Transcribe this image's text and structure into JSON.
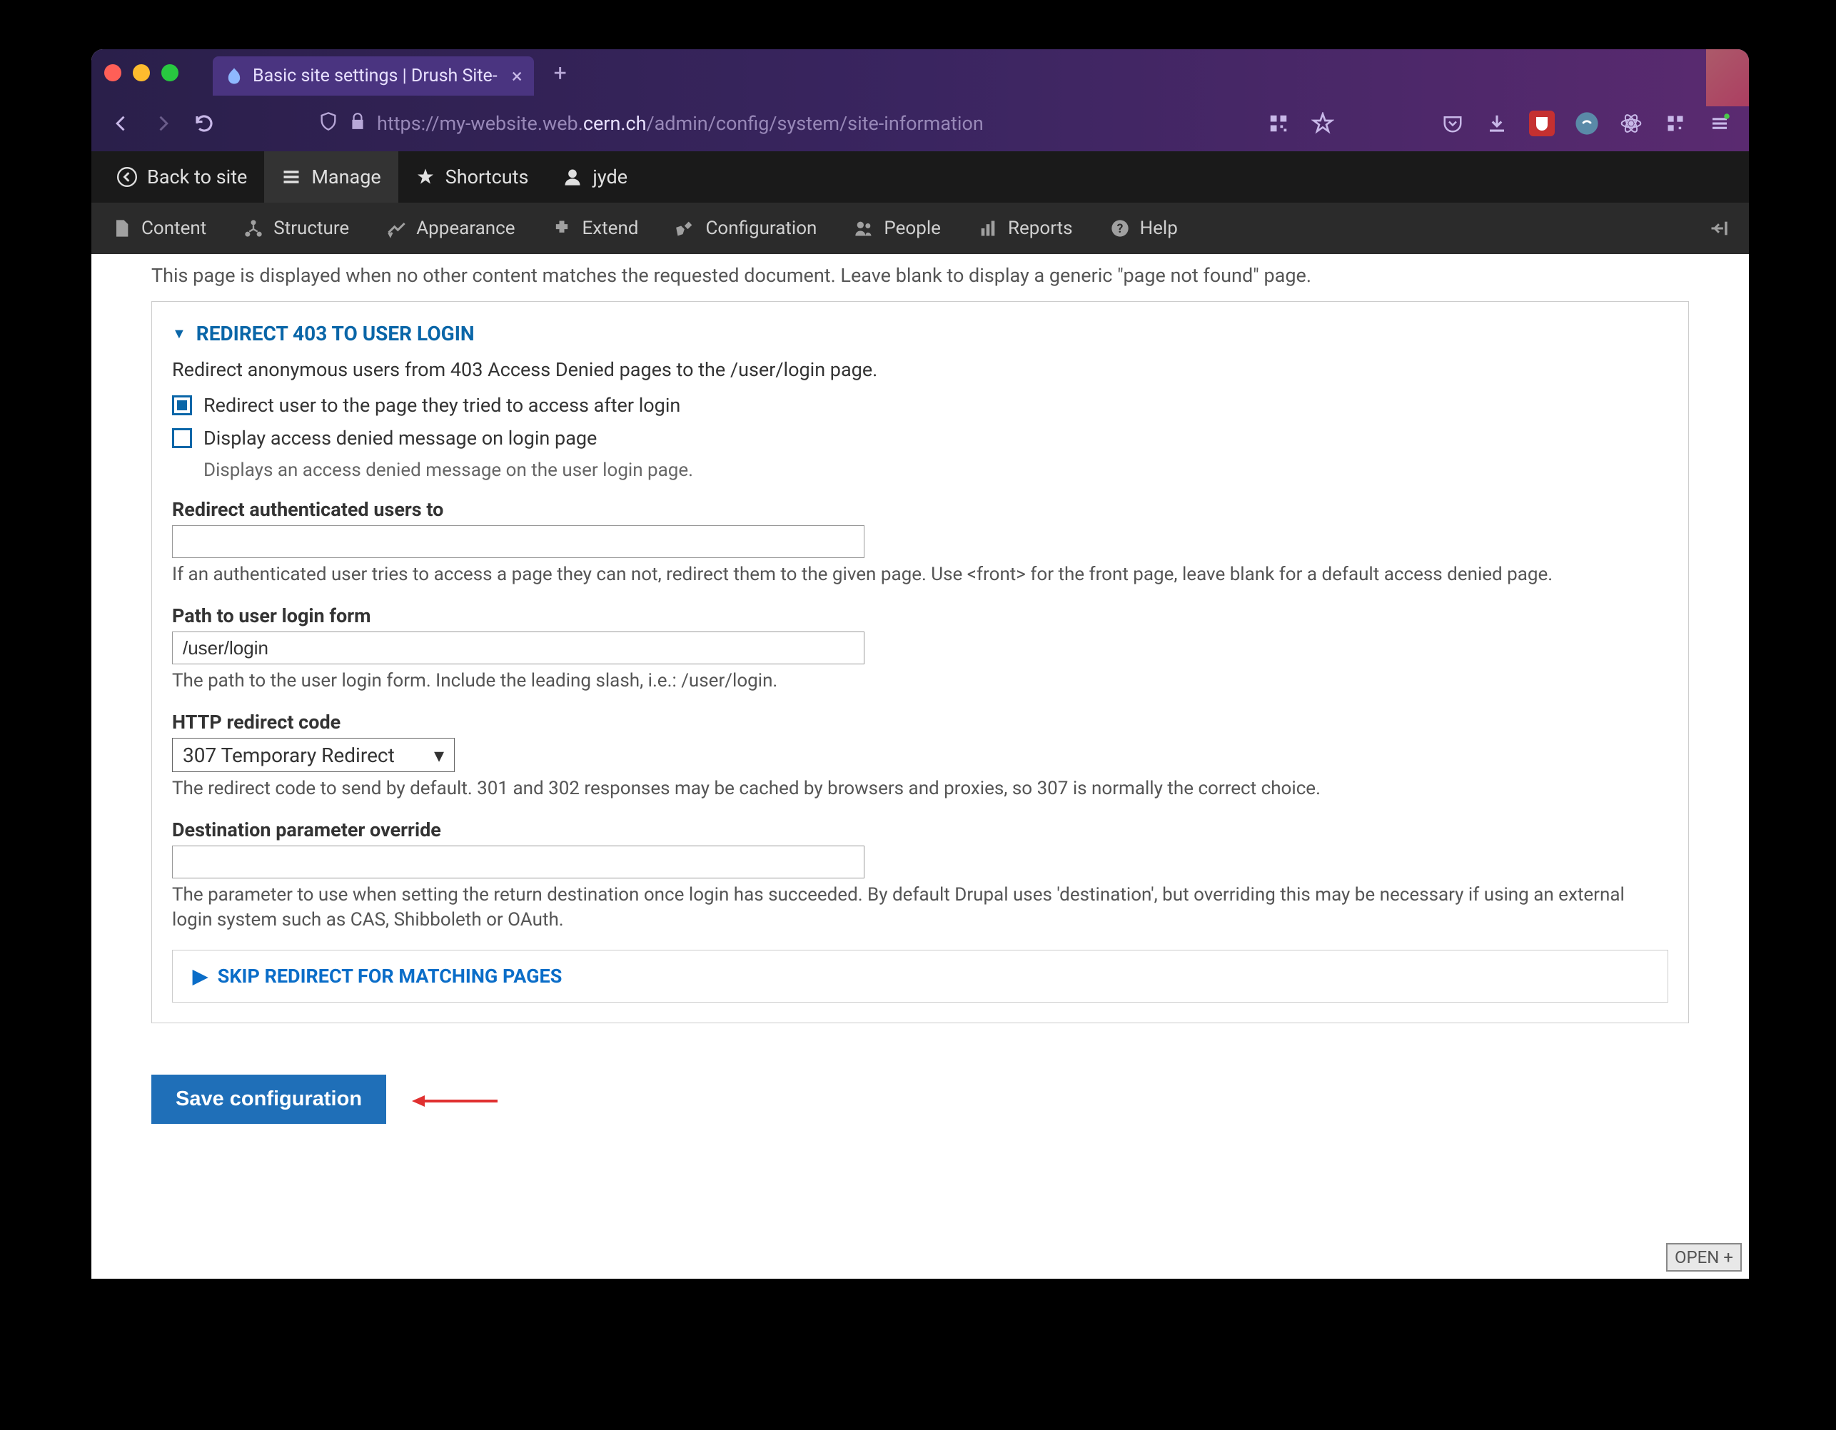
{
  "browser": {
    "tab_title": "Basic site settings | Drush Site-",
    "url_prefix": "https://my-website.web.",
    "url_domain": "cern.ch",
    "url_path": "/admin/config/system/site-information"
  },
  "admin_bar_1": {
    "back_to_site": "Back to site",
    "manage": "Manage",
    "shortcuts": "Shortcuts",
    "user": "jyde"
  },
  "admin_bar_2": {
    "content": "Content",
    "structure": "Structure",
    "appearance": "Appearance",
    "extend": "Extend",
    "configuration": "Configuration",
    "people": "People",
    "reports": "Reports",
    "help": "Help"
  },
  "page": {
    "helper": "This page is displayed when no other content matches the requested document. Leave blank to display a generic \"page not found\" page.",
    "fieldset_title": "REDIRECT 403 TO USER LOGIN",
    "fieldset_desc": "Redirect anonymous users from 403 Access Denied pages to the /user/login page.",
    "cb1_label": "Redirect user to the page they tried to access after login",
    "cb2_label": "Display access denied message on login page",
    "cb2_help": "Displays an access denied message on the user login page.",
    "redirect_auth_label": "Redirect authenticated users to",
    "redirect_auth_value": "",
    "redirect_auth_help": "If an authenticated user tries to access a page they can not, redirect them to the given page. Use <front> for the front page, leave blank for a default access denied page.",
    "path_label": "Path to user login form",
    "path_value": "/user/login",
    "path_help": "The path to the user login form. Include the leading slash, i.e.: /user/login.",
    "http_code_label": "HTTP redirect code",
    "http_code_value": "307 Temporary Redirect",
    "http_code_help": "The redirect code to send by default. 301 and 302 responses may be cached by browsers and proxies, so 307 is normally the correct choice.",
    "dest_label": "Destination parameter override",
    "dest_value": "",
    "dest_help": "The parameter to use when setting the return destination once login has succeeded. By default Drupal uses 'destination', but overriding this may be necessary if using an external login system such as CAS, Shibboleth or OAuth.",
    "skip_title": "SKIP REDIRECT FOR MATCHING PAGES",
    "save_label": "Save configuration"
  },
  "open_badge": "OPEN +"
}
